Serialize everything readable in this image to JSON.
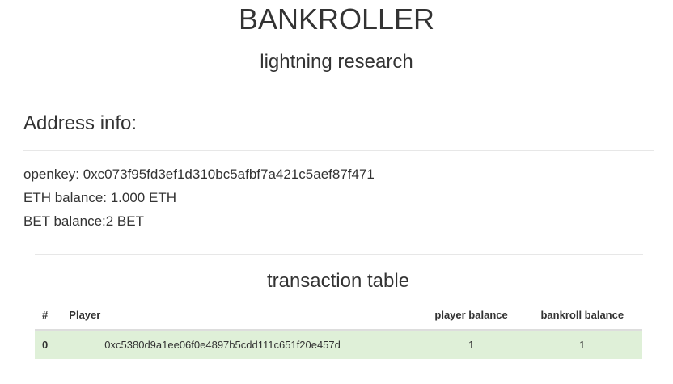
{
  "header": {
    "title": "BANKROLLER",
    "subtitle": "lightning research"
  },
  "address_info": {
    "heading": "Address info:",
    "openkey_line": "openkey: 0xc073f95fd3ef1d310bc5afbf7a421c5aef87f471",
    "eth_line": "ETH balance: 1.000 ETH",
    "bet_line": "BET balance:2 BET"
  },
  "transactions": {
    "title": "transaction table",
    "columns": [
      "#",
      "Player",
      "player balance",
      "bankroll balance"
    ],
    "rows": [
      {
        "index": "0",
        "player": "0xc5380d9a1ee06f0e4897b5cdd111c651f20e457d",
        "player_balance": "1",
        "bankroll_balance": "1"
      }
    ],
    "row_highlight_color": "#dff0d8"
  }
}
